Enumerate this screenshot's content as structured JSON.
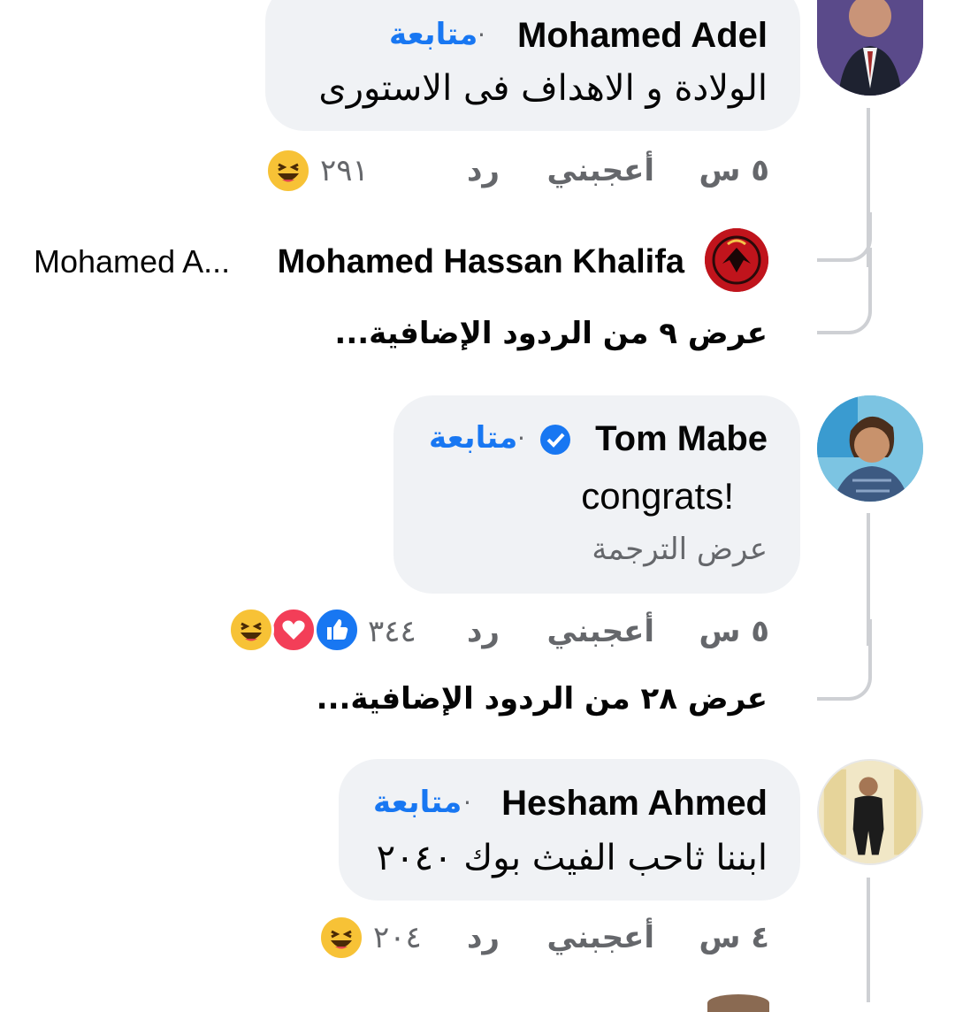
{
  "comments": [
    {
      "author": "Mohamed Adel",
      "follow": "متابعة",
      "text": "الولادة و الاهداف فى الاستورى",
      "time": "٥ س",
      "like": "أعجبني",
      "reply": "رد",
      "reaction_count": "٢٩١",
      "reactions": [
        "haha-icon"
      ]
    },
    {
      "author": "Tom Mabe",
      "verified": true,
      "follow": "متابعة",
      "text": "congrats!",
      "translate": "عرض الترجمة",
      "time": "٥ س",
      "like": "أعجبني",
      "reply": "رد",
      "reaction_count": "٣٤٤",
      "reactions": [
        "like-icon",
        "love-icon",
        "haha-icon"
      ]
    },
    {
      "author": "Hesham Ahmed",
      "follow": "متابعة",
      "text": "ابننا ثاحب الفيث بوك ٢٠٤٠",
      "time": "٤ س",
      "like": "أعجبني",
      "reply": "رد",
      "reaction_count": "٢٠٤",
      "reactions": [
        "haha-icon"
      ]
    }
  ],
  "reply_preview": {
    "author": "Mohamed Hassan Khalifa",
    "snippet": "Mohamed A..."
  },
  "more_replies": [
    "عرض ٩ من الردود الإضافية...",
    "عرض ٢٨ من الردود الإضافية..."
  ],
  "colors": {
    "bubble": "#f0f2f5",
    "link": "#1877f2",
    "meta": "#65676b",
    "thread_line": "#ced0d4"
  }
}
